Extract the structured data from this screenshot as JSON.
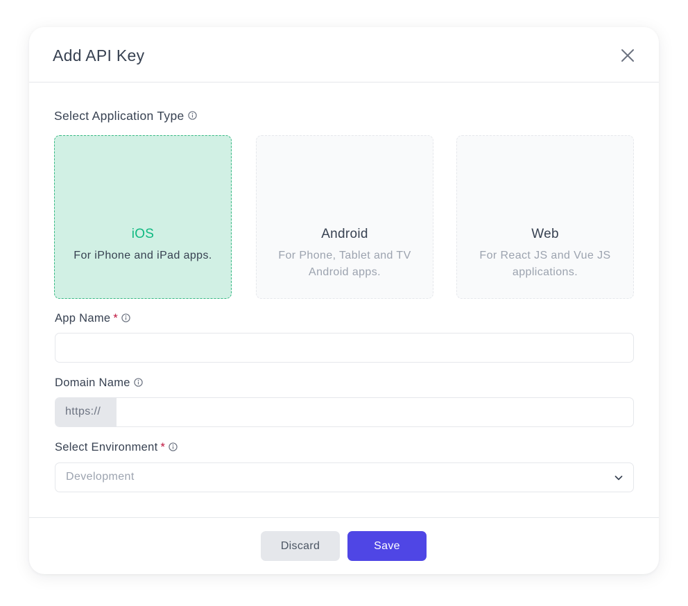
{
  "dialog": {
    "title": "Add API Key",
    "close_icon": "close-icon"
  },
  "application_type": {
    "label": "Select Application Type",
    "info_icon": "info-icon",
    "options": [
      {
        "title": "iOS",
        "description": "For iPhone and iPad apps.",
        "selected": true
      },
      {
        "title": "Android",
        "description": "For Phone, Tablet and TV Android apps.",
        "selected": false
      },
      {
        "title": "Web",
        "description": "For React JS and Vue JS applications.",
        "selected": false
      }
    ]
  },
  "app_name": {
    "label": "App Name",
    "required_mark": "*",
    "value": "",
    "placeholder": ""
  },
  "domain_name": {
    "label": "Domain Name",
    "prefix": "https://",
    "value": "",
    "placeholder": ""
  },
  "environment": {
    "label": "Select Environment",
    "required_mark": "*",
    "selected": "Development",
    "chevron_icon": "chevron-down-icon"
  },
  "footer": {
    "discard_label": "Discard",
    "save_label": "Save"
  },
  "colors": {
    "primary": "#4f46e5",
    "selected_card_bg": "#d1f0e4",
    "selected_card_border": "#34b882",
    "selected_text": "#10b981",
    "required": "#be123c"
  }
}
